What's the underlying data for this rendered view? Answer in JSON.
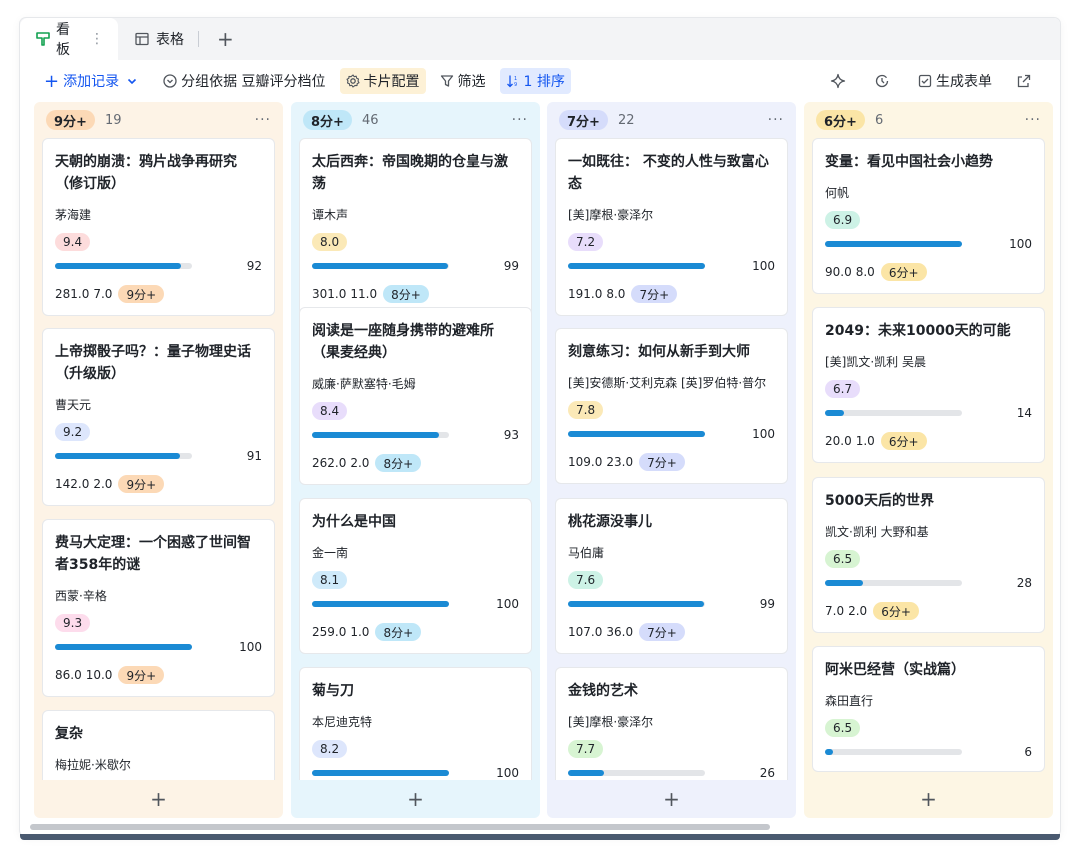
{
  "tabs": [
    {
      "label": "看板",
      "icon": "kanban-icon",
      "active": true
    },
    {
      "label": "表格",
      "icon": "table-icon",
      "active": false
    }
  ],
  "toolbar": {
    "add_record": "添加记录",
    "group_by": "分组依据 豆瓣评分档位",
    "card_config": "卡片配置",
    "filter": "筛选",
    "sort": "1 排序",
    "generate_form": "生成表单"
  },
  "colors": {
    "accent": "#1456f0",
    "progress": "#1a8ad4",
    "col_9": "#fdf3e6",
    "pill_9": "#fcd9b6",
    "col_8": "#e6f5fc",
    "pill_8": "#bfe7f8",
    "col_7": "#eef1fc",
    "pill_7": "#d5dcfb",
    "col_6": "#fdf6e4",
    "pill_6": "#fbe5a6"
  },
  "columns": [
    {
      "label": "9分+",
      "count": "19",
      "cards": [
        {
          "title": "天朝的崩溃：鸦片战争再研究（修订版）",
          "author": "茅海建",
          "score": "9.4",
          "score_bg": "#fddcdc",
          "progress": 92,
          "progress_label": "92",
          "a": "281.0",
          "b": "7.0",
          "tag": "9分+"
        },
        {
          "title": "上帝掷骰子吗？：量子物理史话（升级版）",
          "author": "曹天元",
          "score": "9.2",
          "score_bg": "#dde6fc",
          "progress": 91,
          "progress_label": "91",
          "a": "142.0",
          "b": "2.0",
          "tag": "9分+"
        },
        {
          "title": "费马大定理：一个困惑了世间智者358年的谜",
          "author": "西蒙·辛格",
          "score": "9.3",
          "score_bg": "#fddcec",
          "progress": 100,
          "progress_label": "100",
          "a": "86.0",
          "b": "10.0",
          "tag": "9分+"
        },
        {
          "title": "复杂",
          "author": "梅拉妮·米歇尔",
          "score": "",
          "score_bg": "#dde6fc",
          "progress": 0,
          "progress_label": "",
          "a": "",
          "b": "",
          "tag": ""
        }
      ]
    },
    {
      "label": "8分+",
      "count": "46",
      "cards": [
        {
          "title": "太后西奔：帝国晚期的仓皇与激荡",
          "author": "谭木声",
          "score": "8.0",
          "score_bg": "#fbe9b7",
          "progress": 99,
          "progress_label": "99",
          "a": "301.0",
          "b": "11.0",
          "tag": "8分+"
        },
        {
          "title": "阅读是一座随身携带的避难所（果麦经典）",
          "author": "威廉·萨默塞特·毛姆",
          "score": "8.4",
          "score_bg": "#e8ddfb",
          "progress": 93,
          "progress_label": "93",
          "a": "262.0",
          "b": "2.0",
          "tag": "8分+"
        },
        {
          "title": "为什么是中国",
          "author": "金一南",
          "score": "8.1",
          "score_bg": "#cfeafa",
          "progress": 100,
          "progress_label": "100",
          "a": "259.0",
          "b": "1.0",
          "tag": "8分+"
        },
        {
          "title": "菊与刀",
          "author": "本尼迪克特",
          "score": "8.2",
          "score_bg": "#dde6fc",
          "progress": 100,
          "progress_label": "100",
          "a": "",
          "b": "",
          "tag": ""
        }
      ]
    },
    {
      "label": "7分+",
      "count": "22",
      "cards": [
        {
          "title": "一如既往： 不变的人性与致富心态",
          "author": "[美]摩根·豪泽尔",
          "score": "7.2",
          "score_bg": "#e8ddfb",
          "progress": 100,
          "progress_label": "100",
          "a": "191.0",
          "b": "8.0",
          "tag": "7分+"
        },
        {
          "title": "刻意练习：如何从新手到大师",
          "author": "[美]安德斯·艾利克森 [英]罗伯特·普尔",
          "score": "7.8",
          "score_bg": "#fbe9b7",
          "progress": 100,
          "progress_label": "100",
          "a": "109.0",
          "b": "23.0",
          "tag": "7分+"
        },
        {
          "title": "桃花源没事儿",
          "author": "马伯庸",
          "score": "7.6",
          "score_bg": "#cdf2e6",
          "progress": 99,
          "progress_label": "99",
          "a": "107.0",
          "b": "36.0",
          "tag": "7分+"
        },
        {
          "title": "金钱的艺术",
          "author": "[美]摩根·豪泽尔",
          "score": "7.7",
          "score_bg": "#d7f4d2",
          "progress": 26,
          "progress_label": "26",
          "a": "",
          "b": "",
          "tag": ""
        }
      ]
    },
    {
      "label": "6分+",
      "count": "6",
      "cards": [
        {
          "title": "变量：看见中国社会小趋势",
          "author": "何帆",
          "score": "6.9",
          "score_bg": "#cdf2e6",
          "progress": 100,
          "progress_label": "100",
          "a": "90.0",
          "b": "8.0",
          "tag": "6分+"
        },
        {
          "title": "2049：未来10000天的可能",
          "author": "[美]凯文·凯利 吴晨",
          "score": "6.7",
          "score_bg": "#e8ddfb",
          "progress": 14,
          "progress_label": "14",
          "a": "20.0",
          "b": "1.0",
          "tag": "6分+"
        },
        {
          "title": "5000天后的世界",
          "author": "凯文·凯利 大野和基",
          "score": "6.5",
          "score_bg": "#d7f4d2",
          "progress": 28,
          "progress_label": "28",
          "a": "7.0",
          "b": "2.0",
          "tag": "6分+"
        },
        {
          "title": "阿米巴经营（实战篇）",
          "author": "森田直行",
          "score": "6.5",
          "score_bg": "#d7f4d2",
          "progress": 6,
          "progress_label": "6",
          "a": "",
          "b": "",
          "tag": ""
        }
      ]
    }
  ]
}
